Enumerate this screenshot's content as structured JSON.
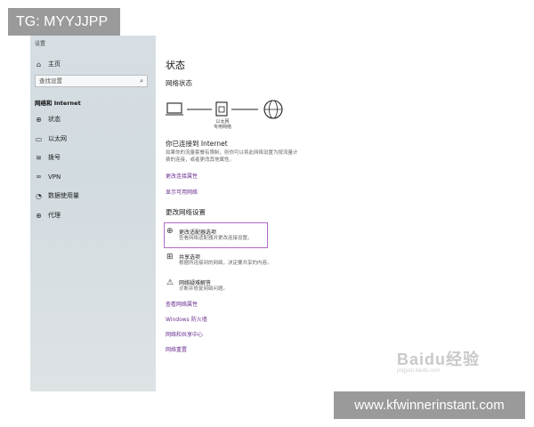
{
  "tag_banner": "TG: MYYJJPP",
  "window": {
    "title": "设置"
  },
  "sidebar": {
    "home": "主页",
    "search_placeholder": "查找设置",
    "section": "网络和 Internet",
    "items": [
      {
        "label": "状态",
        "icon": "globe-icon"
      },
      {
        "label": "以太网",
        "icon": "monitor-icon"
      },
      {
        "label": "拨号",
        "icon": "dialup-icon"
      },
      {
        "label": "VPN",
        "icon": "vpn-icon"
      },
      {
        "label": "数据使用量",
        "icon": "data-usage-icon"
      },
      {
        "label": "代理",
        "icon": "globe-icon"
      }
    ]
  },
  "main": {
    "title": "状态",
    "network_status_heading": "网络状态",
    "connection_label_1": "以太网",
    "connection_label_2": "专用网络",
    "connected_title": "你已连接到 Internet",
    "connected_desc_1": "如果你的流量套餐有限制，则你可以将此网络设置为按流量计",
    "connected_desc_2": "费的连接，或者更改其他属性。",
    "link_connection_properties": "更改连接属性",
    "link_available_networks": "显示可用网络",
    "change_settings_heading": "更改网络设置",
    "options": [
      {
        "title": "更改适配器选项",
        "desc": "查看网络适配器并更改连接设置。",
        "icon": "adapter-icon"
      },
      {
        "title": "共享选项",
        "desc": "根据所连接到的网络，决定要共享的内容。",
        "icon": "sharing-icon"
      },
      {
        "title": "网络疑难解答",
        "desc": "诊断并修复网络问题。",
        "icon": "warning-icon"
      }
    ],
    "links": [
      "查看网络属性",
      "Windows 防火墙",
      "网络和共享中心",
      "网络重置"
    ]
  },
  "watermark": {
    "main": "Baidu经验",
    "sub": "jingyan.baidu.com"
  },
  "url_banner": "www.kfwinnerinstant.com"
}
